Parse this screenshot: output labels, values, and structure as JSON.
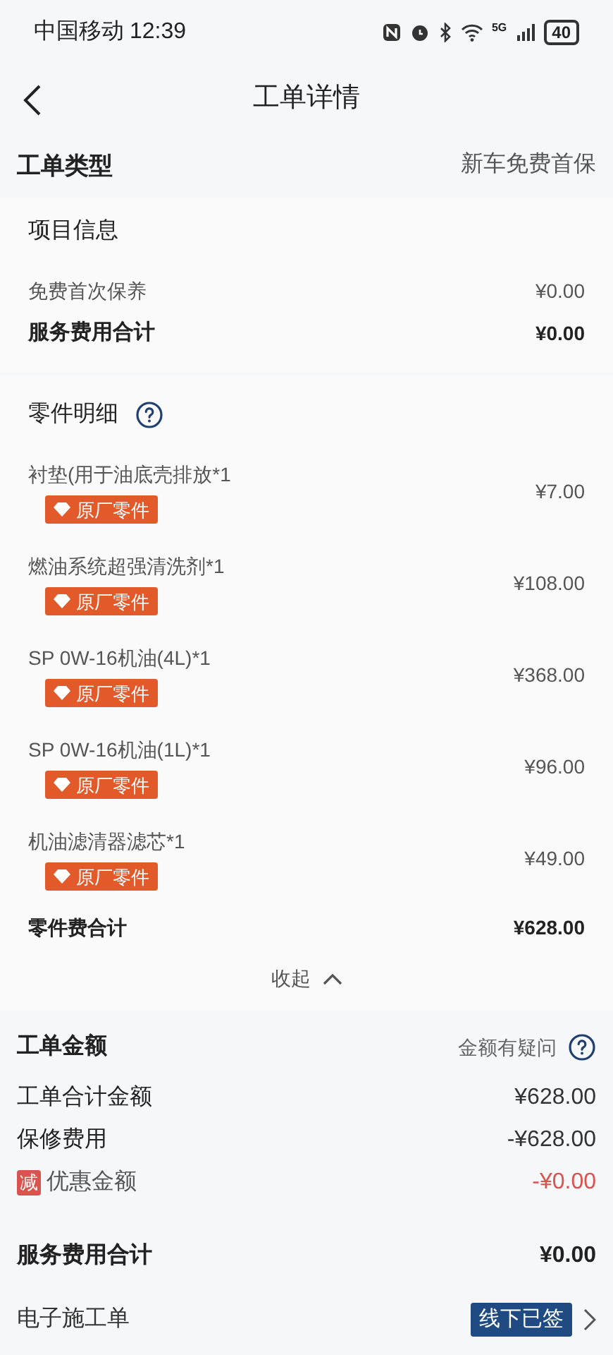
{
  "status_bar": {
    "carrier": "中国移动",
    "time": "12:39",
    "network": "5G",
    "battery": "40"
  },
  "header": {
    "title": "工单详情"
  },
  "order_type": {
    "label": "工单类型",
    "value": "新车免费首保"
  },
  "project": {
    "title": "项目信息",
    "rows": [
      {
        "label": "免费首次保养",
        "value": "¥0.00",
        "bold": false
      },
      {
        "label": "服务费用合计",
        "value": "¥0.00",
        "bold": true
      }
    ]
  },
  "parts": {
    "title": "零件明细",
    "items": [
      {
        "name": "衬垫(用于油底壳排放*1",
        "tag": "原厂零件",
        "price": "¥7.00"
      },
      {
        "name": "燃油系统超强清洗剂*1",
        "tag": "原厂零件",
        "price": "¥108.00"
      },
      {
        "name": "SP 0W-16机油(4L)*1",
        "tag": "原厂零件",
        "price": "¥368.00"
      },
      {
        "name": "SP 0W-16机油(1L)*1",
        "tag": "原厂零件",
        "price": "¥96.00"
      },
      {
        "name": "机油滤清器滤芯*1",
        "tag": "原厂零件",
        "price": "¥49.00"
      }
    ],
    "total_label": "零件费合计",
    "total": "¥628.00",
    "collapse": "收起",
    "expanded": true
  },
  "amount": {
    "title": "工单金额",
    "question": "金额有疑问",
    "rows": [
      {
        "kind": "plain",
        "label": "工单合计金额",
        "value": "¥628.00"
      },
      {
        "kind": "plain",
        "label": "保修费用",
        "value": "-¥628.00"
      },
      {
        "kind": "discount",
        "badge": "减",
        "label": "优惠金额",
        "value": "-¥0.00"
      }
    ],
    "total_label": "服务费用合计",
    "total": "¥0.00"
  },
  "e_order": {
    "label": "电子施工单",
    "status": "线下已签"
  }
}
